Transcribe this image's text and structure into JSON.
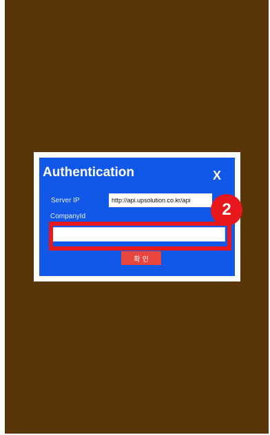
{
  "dialog": {
    "title": "Authentication",
    "close_label": "X",
    "server_ip_label": "Server IP",
    "server_ip_value": "http://api.upsolution.co.kr/api",
    "company_id_label": "CompanyId",
    "company_id_value": "",
    "confirm_label": "확 인"
  },
  "annotation": {
    "step_number": "2",
    "highlight_color": "#e8171c"
  },
  "colors": {
    "background": "#5a3508",
    "dialog": "#1157e8",
    "confirm_button": "#e8453c"
  }
}
